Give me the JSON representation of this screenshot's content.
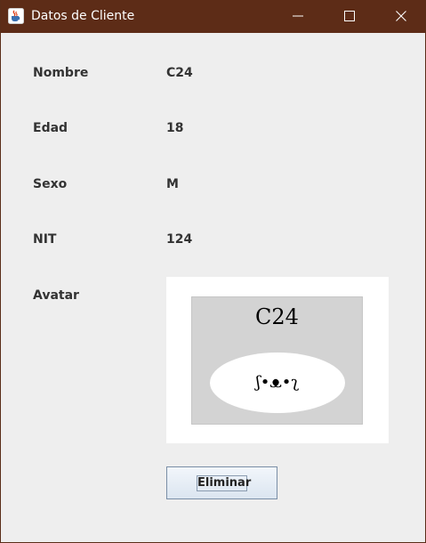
{
  "window": {
    "title": "Datos de Cliente",
    "app_icon": "java-coffee-icon",
    "controls": [
      "minimize-icon",
      "maximize-icon",
      "close-icon"
    ]
  },
  "form": {
    "nombre_label": "Nombre",
    "nombre_value": "C24",
    "edad_label": "Edad",
    "edad_value": "18",
    "sexo_label": "Sexo",
    "sexo_value": "M",
    "nit_label": "NIT",
    "nit_value": "124",
    "avatar_label": "Avatar"
  },
  "avatar": {
    "name_text": "C24",
    "face_text": "ʃ•ᴥ•ʅ"
  },
  "actions": {
    "delete_label": "Eliminar"
  },
  "colors": {
    "titlebar": "#5d2c17",
    "background": "#eeeeee",
    "avatar_frame": "#d3d3d3"
  }
}
